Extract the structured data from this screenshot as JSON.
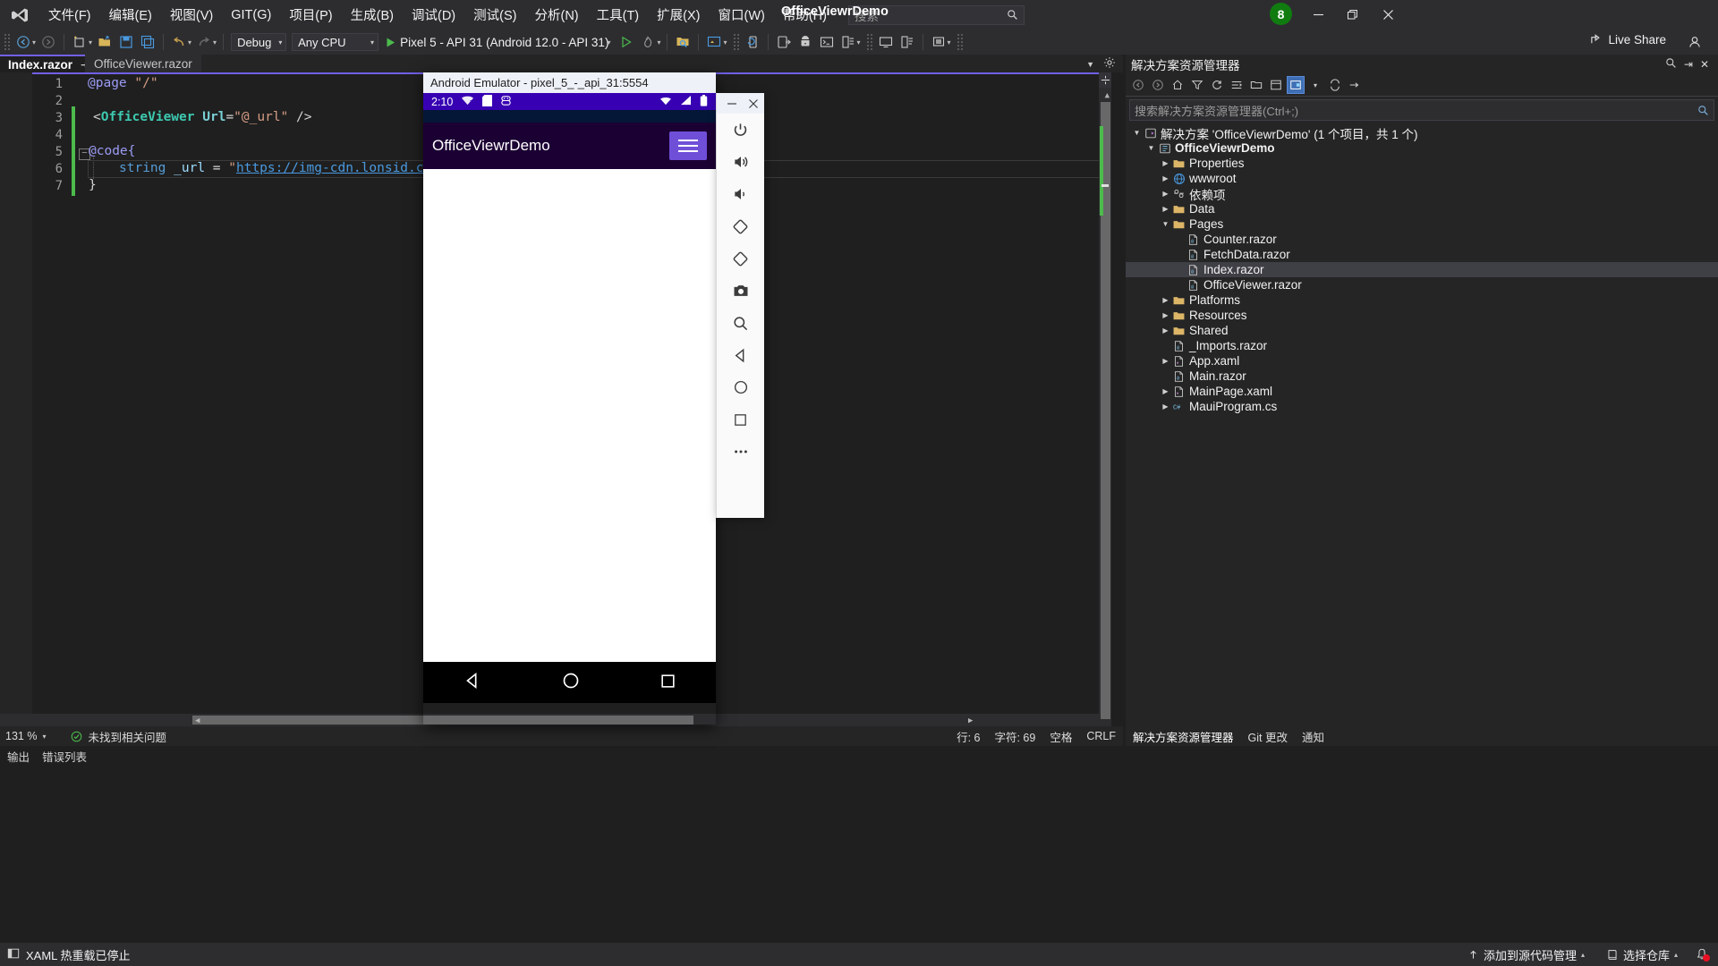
{
  "app": {
    "window_title": "OfficeViewrDemo",
    "notification_count": "8"
  },
  "menu": {
    "items": [
      {
        "label": "文件(F)"
      },
      {
        "label": "编辑(E)"
      },
      {
        "label": "视图(V)"
      },
      {
        "label": "GIT(G)"
      },
      {
        "label": "项目(P)"
      },
      {
        "label": "生成(B)"
      },
      {
        "label": "调试(D)"
      },
      {
        "label": "测试(S)"
      },
      {
        "label": "分析(N)"
      },
      {
        "label": "工具(T)"
      },
      {
        "label": "扩展(X)"
      },
      {
        "label": "窗口(W)"
      },
      {
        "label": "帮助(H)"
      }
    ],
    "search_placeholder": "搜索"
  },
  "titlebar_buttons": {
    "minimize": "—",
    "maximize": "❐",
    "close": "✕"
  },
  "toolbar": {
    "configuration": "Debug",
    "platform": "Any CPU",
    "run_target": "Pixel 5 - API 31 (Android 12.0 - API 31)",
    "live_share": "Live Share"
  },
  "editor": {
    "tabs": [
      {
        "label": "Index.razor",
        "active": true
      },
      {
        "label": "OfficeViewer.razor",
        "active": false
      }
    ],
    "line_numbers": [
      "1",
      "2",
      "3",
      "4",
      "5",
      "6",
      "7"
    ],
    "code": {
      "line1_page": "@page",
      "line1_route": "\"/\"",
      "line3_open": "<",
      "line3_tag": "OfficeViewer",
      "line3_attr": "Url",
      "line3_eq": "=",
      "line3_val": "\"@_url\"",
      "line3_close": "/>",
      "line5": "@code{",
      "line6_kw": "string",
      "line6_var": "_url",
      "line6_eq": "=",
      "line6_quote": "\"",
      "line6_url": "https://img-cdn.lonsid.cn/down",
      "line7": "}"
    },
    "status": {
      "zoom": "131 %",
      "problems": "未找到相关问题",
      "line": "行: 6",
      "column": "字符: 69",
      "spaces": "空格",
      "eol": "CRLF"
    },
    "bottom_tabs": [
      {
        "label": "输出"
      },
      {
        "label": "错误列表"
      }
    ]
  },
  "solution_explorer": {
    "title": "解决方案资源管理器",
    "search_placeholder": "搜索解决方案资源管理器(Ctrl+;)",
    "tree": [
      {
        "level": 0,
        "arrow": "▲",
        "icon": "solution",
        "label": "解决方案 'OfficeViewrDemo' (1 个项目，共 1 个)",
        "bold": false,
        "selected": false
      },
      {
        "level": 1,
        "arrow": "▲",
        "icon": "project",
        "label": "OfficeViewrDemo",
        "bold": true,
        "selected": false
      },
      {
        "level": 2,
        "arrow": "▶",
        "icon": "folder",
        "label": "Properties",
        "bold": false,
        "selected": false
      },
      {
        "level": 2,
        "arrow": "▶",
        "icon": "globe",
        "label": "wwwroot",
        "bold": false,
        "selected": false
      },
      {
        "level": 2,
        "arrow": "▶",
        "icon": "deps",
        "label": "依赖项",
        "bold": false,
        "selected": false
      },
      {
        "level": 2,
        "arrow": "▶",
        "icon": "folder",
        "label": "Data",
        "bold": false,
        "selected": false
      },
      {
        "level": 2,
        "arrow": "▲",
        "icon": "folder",
        "label": "Pages",
        "bold": false,
        "selected": false
      },
      {
        "level": 3,
        "arrow": "",
        "icon": "razor",
        "label": "Counter.razor",
        "bold": false,
        "selected": false
      },
      {
        "level": 3,
        "arrow": "",
        "icon": "razor",
        "label": "FetchData.razor",
        "bold": false,
        "selected": false
      },
      {
        "level": 3,
        "arrow": "",
        "icon": "razor",
        "label": "Index.razor",
        "bold": false,
        "selected": true
      },
      {
        "level": 3,
        "arrow": "",
        "icon": "razor",
        "label": "OfficeViewer.razor",
        "bold": false,
        "selected": false
      },
      {
        "level": 2,
        "arrow": "▶",
        "icon": "folder",
        "label": "Platforms",
        "bold": false,
        "selected": false
      },
      {
        "level": 2,
        "arrow": "▶",
        "icon": "folder",
        "label": "Resources",
        "bold": false,
        "selected": false
      },
      {
        "level": 2,
        "arrow": "▶",
        "icon": "folder",
        "label": "Shared",
        "bold": false,
        "selected": false
      },
      {
        "level": 2,
        "arrow": "",
        "icon": "razor",
        "label": "_Imports.razor",
        "bold": false,
        "selected": false
      },
      {
        "level": 2,
        "arrow": "▶",
        "icon": "xaml",
        "label": "App.xaml",
        "bold": false,
        "selected": false
      },
      {
        "level": 2,
        "arrow": "",
        "icon": "razor",
        "label": "Main.razor",
        "bold": false,
        "selected": false
      },
      {
        "level": 2,
        "arrow": "▶",
        "icon": "xaml",
        "label": "MainPage.xaml",
        "bold": false,
        "selected": false
      },
      {
        "level": 2,
        "arrow": "▶",
        "icon": "cs",
        "label": "MauiProgram.cs",
        "bold": false,
        "selected": false
      }
    ],
    "bottom_tabs": [
      {
        "label": "解决方案资源管理器",
        "selected": true
      },
      {
        "label": "Git 更改",
        "selected": false
      },
      {
        "label": "通知",
        "selected": false
      }
    ]
  },
  "emulator": {
    "window_title": "Android Emulator - pixel_5_-_api_31:5554",
    "window_buttons": {
      "minimize": "—",
      "restore": "❐",
      "close": "✕"
    },
    "status_time": "2:10",
    "app_title": "OfficeViewrDemo",
    "toolbar_icons": [
      "power-icon",
      "volume-up-icon",
      "volume-down-icon",
      "rotate-left-icon",
      "rotate-right-icon",
      "camera-icon",
      "zoom-icon",
      "back-icon",
      "home-icon",
      "overview-icon",
      "more-icon"
    ],
    "nav_buttons": [
      "back-triangle",
      "home-circle",
      "recents-square"
    ]
  },
  "statusbar": {
    "left_text": "XAML 热重载已停止",
    "source_control": "添加到源代码管理",
    "repo": "选择仓库"
  },
  "colors": {
    "accent_purple": "#7160e8",
    "android_purple": "#3700b3",
    "appbar": "#1b0033",
    "hamburger": "#6f4fd8",
    "run_green": "#4cbb4c",
    "badge_green": "#107c10",
    "notify_red": "#e81123"
  }
}
